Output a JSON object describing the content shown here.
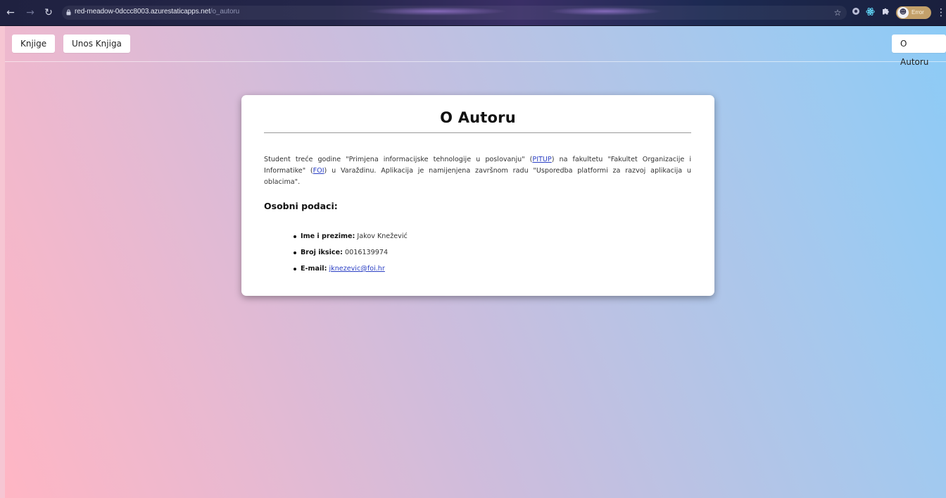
{
  "browser": {
    "url_host": "red-meadow-0dccc8003.azurestaticapps.net",
    "url_path": "/o_autoru",
    "profile_label": "Error",
    "nav_icons": {
      "back": "back-arrow-icon",
      "forward": "forward-arrow-icon",
      "reload": "reload-icon"
    },
    "extension_icons": [
      "star-icon",
      "extension-circle-icon",
      "react-devtools-icon",
      "puzzle-icon"
    ]
  },
  "nav": {
    "books_label": "Knjige",
    "add_book_label": "Unos Knjiga",
    "about_label": "O Autoru"
  },
  "card": {
    "title": "O Autoru",
    "intro": {
      "part1": "Student treće godine \"Primjena informacijske tehnologije u poslovanju\" (",
      "link1": "PITUP",
      "part2": ") na fakultetu \"Fakultet Organizacije i Informatike\" (",
      "link2": "FOI",
      "part3": ") u Varaždinu. Aplikacija je namijenjena završnom radu \"Usporedba platformi za razvoj aplikacija u oblacima\"."
    },
    "section_title": "Osobni podaci:",
    "details": [
      {
        "label": "Ime i prezime:",
        "value": "Jakov Knežević"
      },
      {
        "label": "Broj iksice:",
        "value": "0016139974"
      },
      {
        "label": "E-mail:",
        "value": "jknezevic@foi.hr"
      }
    ]
  },
  "colors": {
    "background_start": "#ffb6c4",
    "background_end": "#8ccbf6",
    "link": "#2a3fc4",
    "card": "#ffffff"
  }
}
